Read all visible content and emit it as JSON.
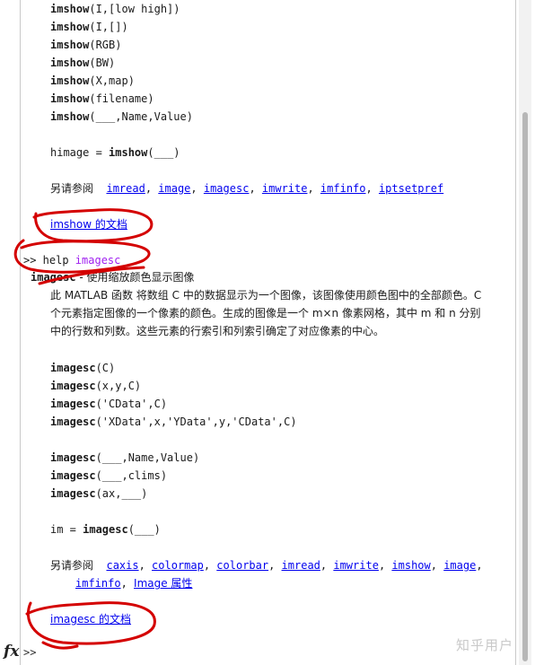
{
  "imshow_syntax": [
    {
      "fn": "imshow",
      "args": "(I,[low high])"
    },
    {
      "fn": "imshow",
      "args": "(I,[])"
    },
    {
      "fn": "imshow",
      "args": "(RGB)"
    },
    {
      "fn": "imshow",
      "args": "(BW)"
    },
    {
      "fn": "imshow",
      "args": "(X,map)"
    },
    {
      "fn": "imshow",
      "args": "(filename)"
    },
    {
      "fn": "imshow",
      "args": "(___,Name,Value)"
    }
  ],
  "imshow_himage": {
    "lhs": "himage = ",
    "fn": "imshow",
    "args": "(___)"
  },
  "imshow_see_also": {
    "label": "另请参阅",
    "links": [
      "imread",
      "image",
      "imagesc",
      "imwrite",
      "imfinfo",
      "iptsetpref"
    ]
  },
  "imshow_doc_link": "imshow 的文档",
  "command": {
    "prompt": ">> help ",
    "arg": "imagesc"
  },
  "imagesc_heading": {
    "fn": "imagesc",
    "desc": " - 使用缩放颜色显示图像"
  },
  "imagesc_desc": [
    "此 MATLAB 函数 将数组 C 中的数据显示为一个图像，该图像使用颜色图中的全部颜色。C",
    "个元素指定图像的一个像素的颜色。生成的图像是一个 m×n 像素网格，其中 m 和 n 分别",
    "中的行数和列数。这些元素的行索引和列索引确定了对应像素的中心。"
  ],
  "imagesc_syntax_a": [
    {
      "fn": "imagesc",
      "args": "(C)"
    },
    {
      "fn": "imagesc",
      "args": "(x,y,C)"
    },
    {
      "fn": "imagesc",
      "args": "('CData',C)"
    },
    {
      "fn": "imagesc",
      "args": "('XData',x,'YData',y,'CData',C)"
    }
  ],
  "imagesc_syntax_b": [
    {
      "fn": "imagesc",
      "args": "(___,Name,Value)"
    },
    {
      "fn": "imagesc",
      "args": "(___,clims)"
    },
    {
      "fn": "imagesc",
      "args": "(ax,___)"
    }
  ],
  "imagesc_im": {
    "lhs": "im = ",
    "fn": "imagesc",
    "args": "(___)"
  },
  "imagesc_see_also": {
    "label": "另请参阅",
    "links_line1": [
      "caxis",
      "colormap",
      "colorbar",
      "imread",
      "imwrite",
      "imshow",
      "image"
    ],
    "links_line2": [
      "imfinfo",
      "Image 属性"
    ]
  },
  "imagesc_doc_link": "imagesc 的文档",
  "bottom_prompt": ">>",
  "fx_label": "fx",
  "watermark": "知乎用户",
  "colors": {
    "link": "#0000ee",
    "keyword_purple": "#a020f0",
    "annotation": "#d40000"
  }
}
